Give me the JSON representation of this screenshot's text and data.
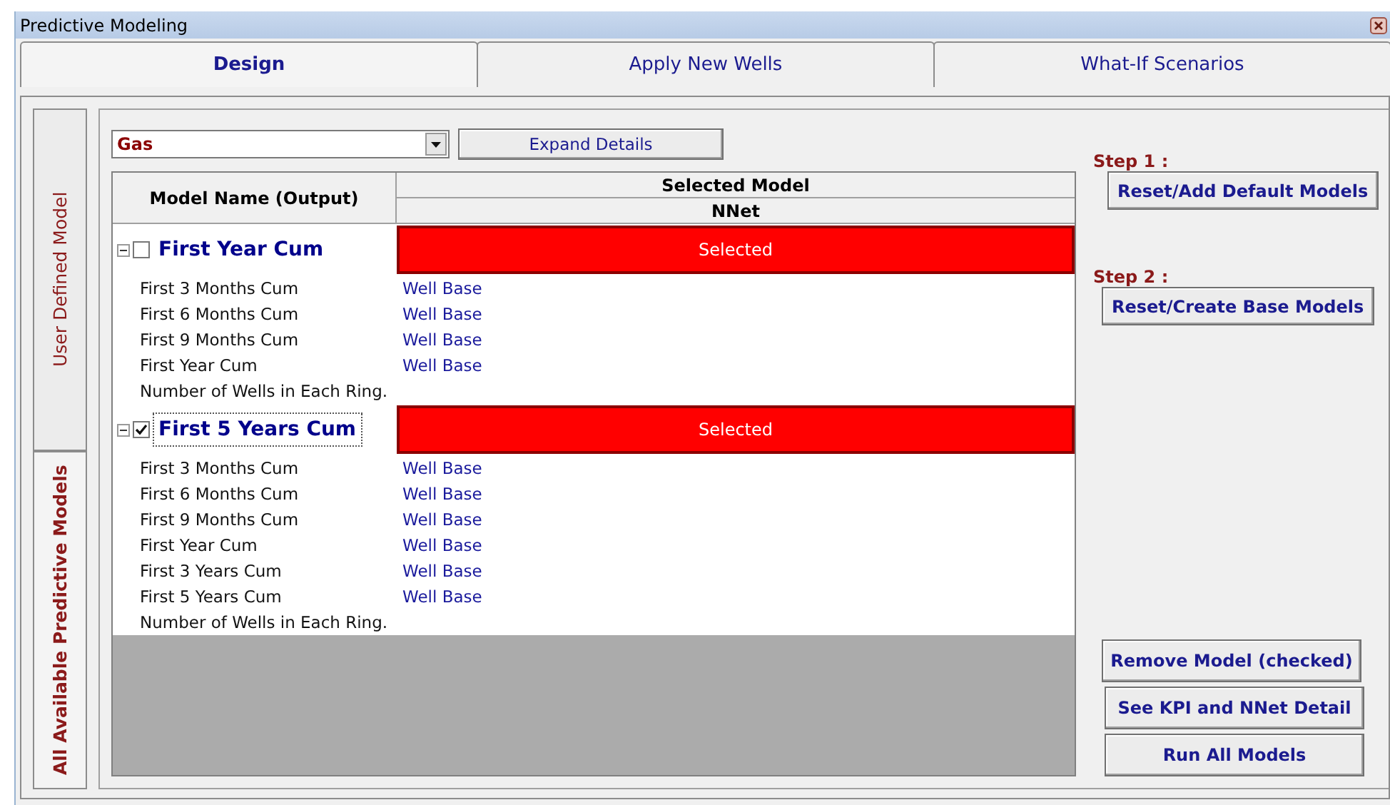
{
  "window": {
    "title": "Predictive Modeling"
  },
  "tabs": [
    {
      "label": "Design",
      "selected": true
    },
    {
      "label": "Apply New Wells",
      "selected": false
    },
    {
      "label": "What-If Scenarios",
      "selected": false
    }
  ],
  "side_tabs": [
    {
      "label": "User Defined Model",
      "selected": false
    },
    {
      "label": "All Available Predictive Models",
      "selected": true
    }
  ],
  "output_dropdown": {
    "value": "Gas"
  },
  "expand_button": "Expand Details",
  "table": {
    "name_column": "Model Name (Output)",
    "group_header": "Selected Model",
    "model_header": "NNet",
    "models": [
      {
        "name": "First Year Cum",
        "expanded": true,
        "checked": false,
        "focused": false,
        "status": "Selected",
        "inputs": [
          {
            "name": "First 3 Months Cum",
            "source": "Well Base"
          },
          {
            "name": "First 6 Months Cum",
            "source": "Well Base"
          },
          {
            "name": "First 9 Months Cum",
            "source": "Well Base"
          },
          {
            "name": "First Year Cum",
            "source": "Well Base"
          },
          {
            "name": "Number of Wells in Each Ring."
          }
        ]
      },
      {
        "name": "First 5 Years Cum",
        "expanded": true,
        "checked": true,
        "focused": true,
        "status": "Selected",
        "inputs": [
          {
            "name": "First 3 Months Cum",
            "source": "Well Base"
          },
          {
            "name": "First 6 Months Cum",
            "source": "Well Base"
          },
          {
            "name": "First 9 Months Cum",
            "source": "Well Base"
          },
          {
            "name": "First Year Cum",
            "source": "Well Base"
          },
          {
            "name": "First 3 Years Cum",
            "source": "Well Base"
          },
          {
            "name": "First 5 Years Cum",
            "source": "Well Base"
          },
          {
            "name": "Number of Wells in Each Ring."
          }
        ]
      }
    ]
  },
  "steps": [
    {
      "label": "Step 1 :",
      "button": "Reset/Add Default Models"
    },
    {
      "label": "Step 2 :",
      "button": "Reset/Create Base Models"
    }
  ],
  "actions": [
    "Remove Model (checked)",
    "See KPI and NNet Detail",
    "Run All Models"
  ]
}
